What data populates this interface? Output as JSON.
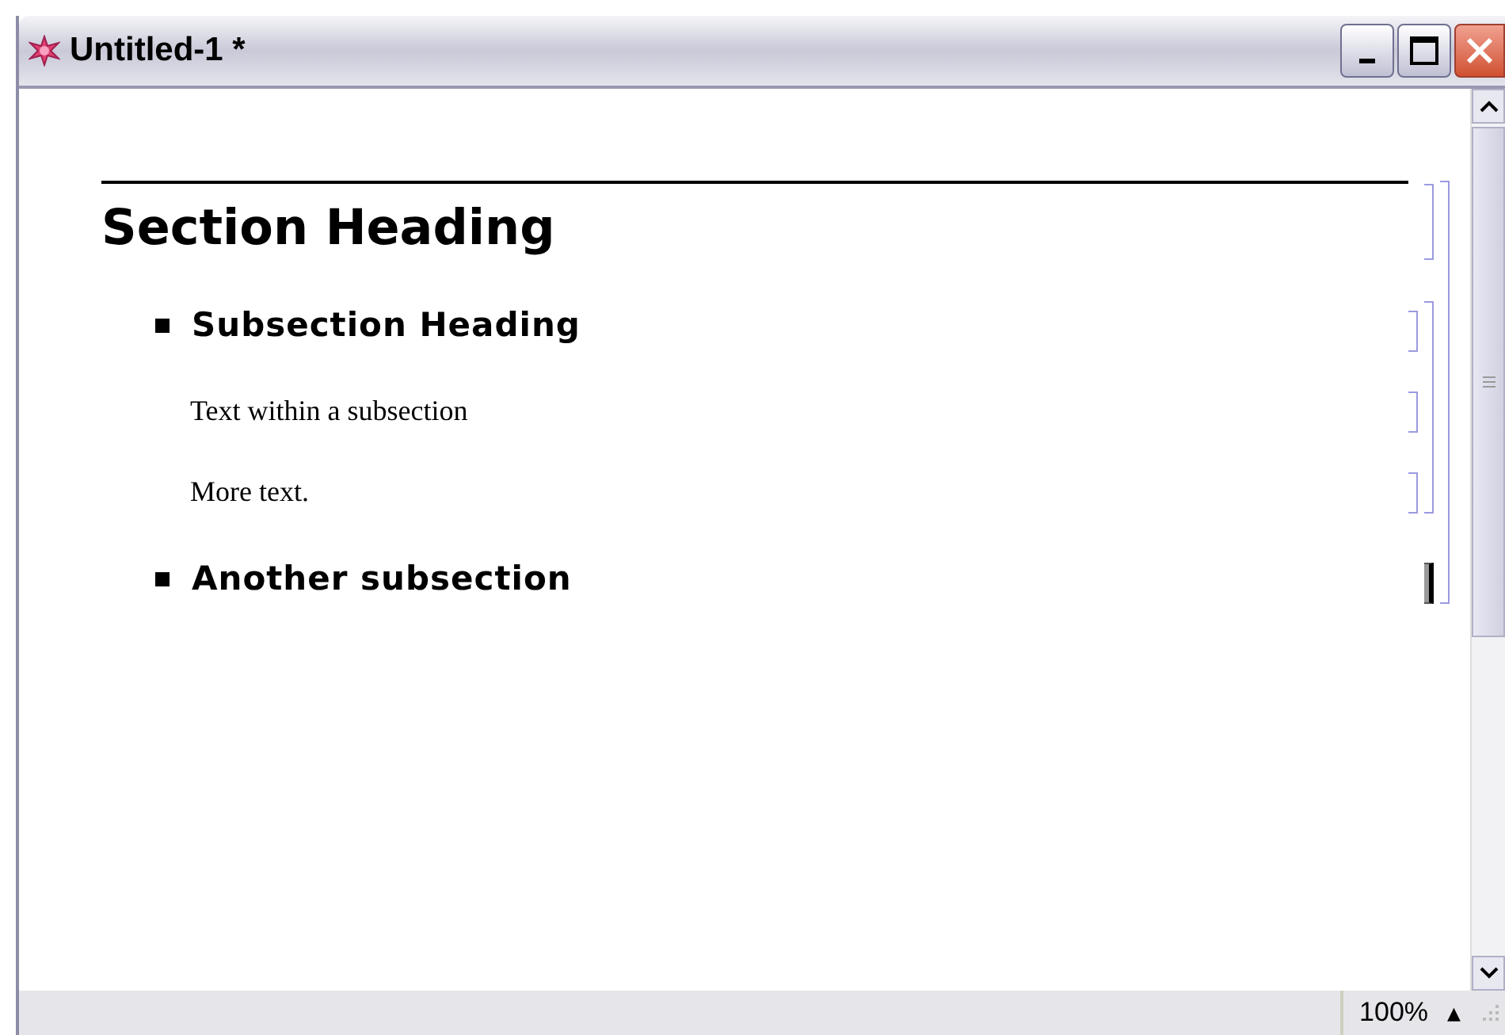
{
  "window": {
    "title": "Untitled-1 *"
  },
  "cells": [
    {
      "kind": "section",
      "text": "Section Heading",
      "selected": false,
      "children": [
        {
          "kind": "subsection",
          "text": "Subsection Heading",
          "selected": false,
          "children": [
            {
              "kind": "text",
              "text": "Text within a subsection",
              "selected": false
            },
            {
              "kind": "text",
              "text": "More text.",
              "selected": false
            }
          ]
        },
        {
          "kind": "subsection",
          "text": "Another subsection",
          "selected": true
        }
      ]
    }
  ],
  "status_bar": {
    "zoom": "100%",
    "zoom_arrow": "▲"
  }
}
